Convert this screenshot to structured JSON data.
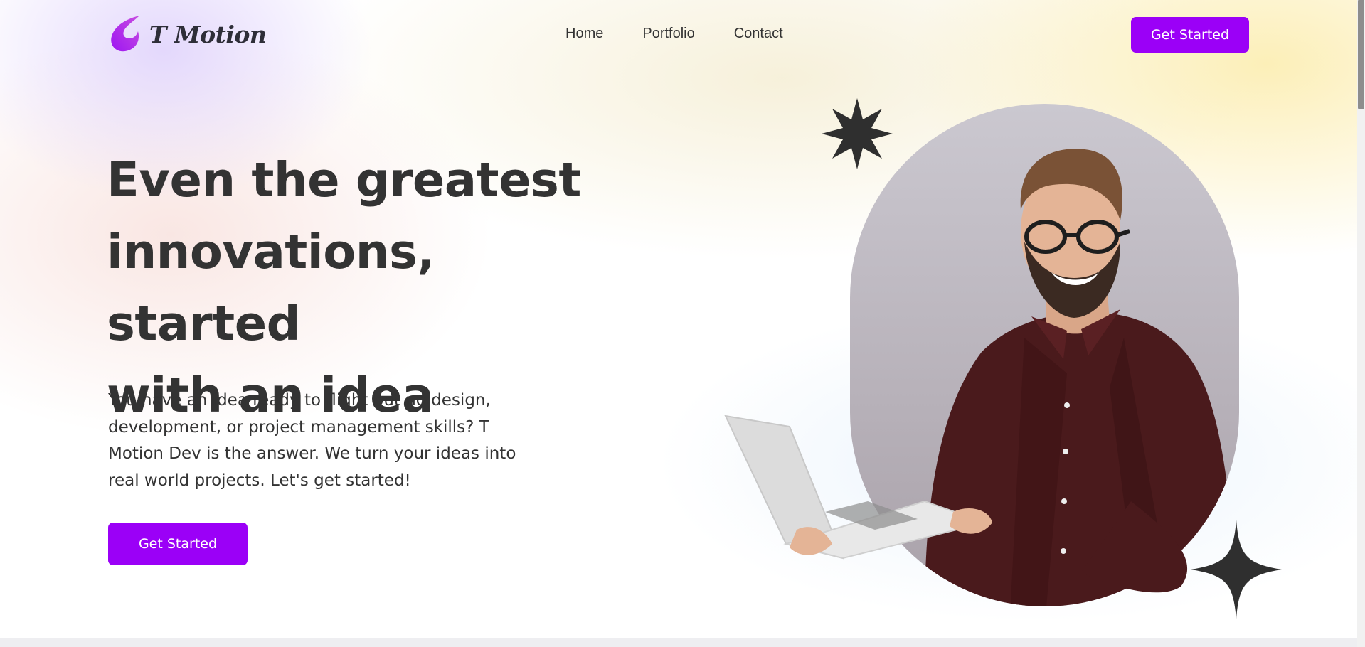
{
  "header": {
    "logo_text": "T Motion",
    "logo_icon": "flame-swirl-icon",
    "nav": [
      {
        "label": "Home"
      },
      {
        "label": "Portfolio"
      },
      {
        "label": "Contact"
      }
    ],
    "cta_label": "Get Started"
  },
  "hero": {
    "title_lines": [
      "Even the greatest",
      "innovations, started",
      "with an idea"
    ],
    "description": "You have an idea ready to flight but no design, development, or project management skills? T Motion Dev is the answer. We turn your ideas into real world projects. Let's get started!",
    "cta_label": "Get Started",
    "decorations": [
      "eight-point-star-icon",
      "four-point-sparkle-icon"
    ]
  },
  "colors": {
    "accent": "#9b00f7",
    "text": "#333333",
    "star": "#2f2f2f",
    "oval": "#bcb6c2"
  }
}
